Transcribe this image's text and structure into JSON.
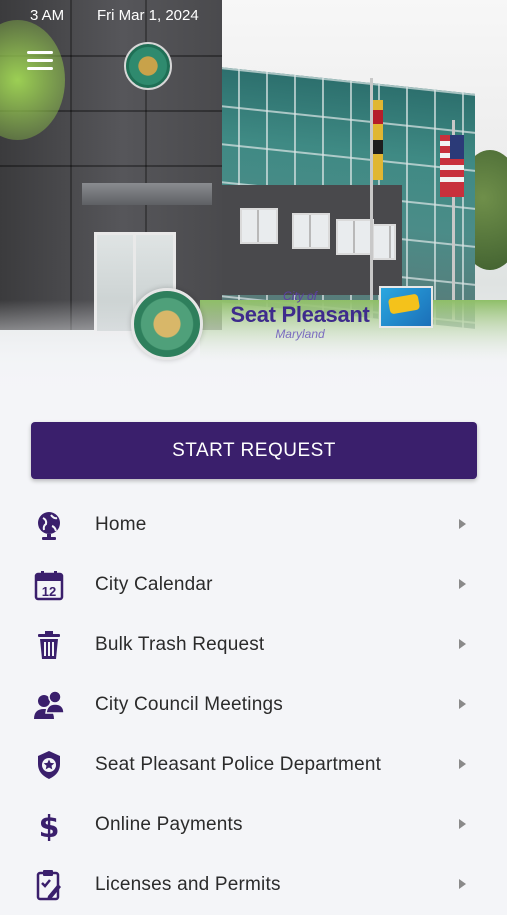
{
  "status_bar": {
    "time": "3 AM",
    "date": "Fri Mar 1, 2024"
  },
  "hero": {
    "logo": {
      "prefix": "City of",
      "name": "Seat Pleasant",
      "state": "Maryland"
    }
  },
  "start_button": {
    "label": "START REQUEST"
  },
  "colors": {
    "accent": "#3a1f6c",
    "icon": "#3a1f6c",
    "chevron": "#8a8a8a"
  },
  "menu": {
    "items": [
      {
        "label": "Home",
        "icon": "globe-icon"
      },
      {
        "label": "City Calendar",
        "icon": "calendar-icon"
      },
      {
        "label": "Bulk Trash Request",
        "icon": "trash-icon"
      },
      {
        "label": "City Council Meetings",
        "icon": "people-icon"
      },
      {
        "label": "Seat Pleasant Police Department",
        "icon": "police-badge-icon"
      },
      {
        "label": "Online Payments",
        "icon": "dollar-icon"
      },
      {
        "label": "Licenses and Permits",
        "icon": "clipboard-icon"
      }
    ]
  }
}
